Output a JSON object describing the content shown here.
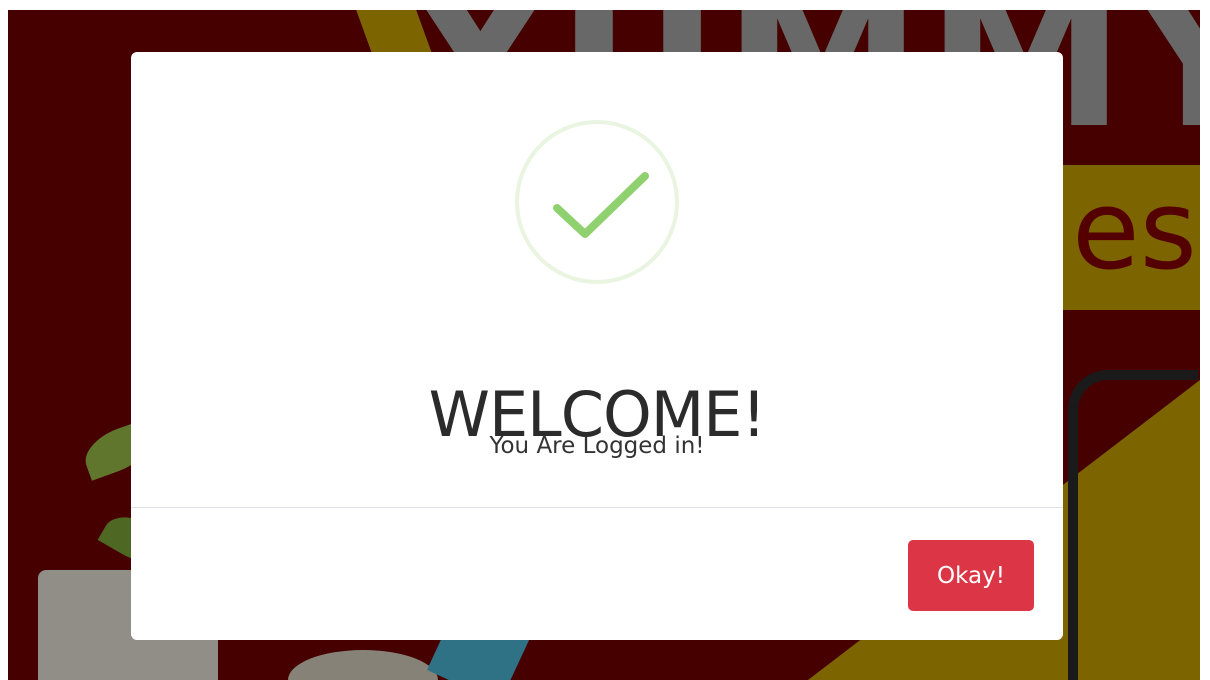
{
  "background": {
    "banner_word": "YUMMY",
    "banner_suffix": "es"
  },
  "modal": {
    "icon": "checkmark-icon",
    "title": "WELCOME!",
    "message": "You Are Logged in!",
    "ok_label": "Okay!"
  },
  "colors": {
    "success": "#8fd16f",
    "danger": "#dc3545",
    "banner_red": "#720000",
    "banner_yellow": "#c9a300"
  }
}
